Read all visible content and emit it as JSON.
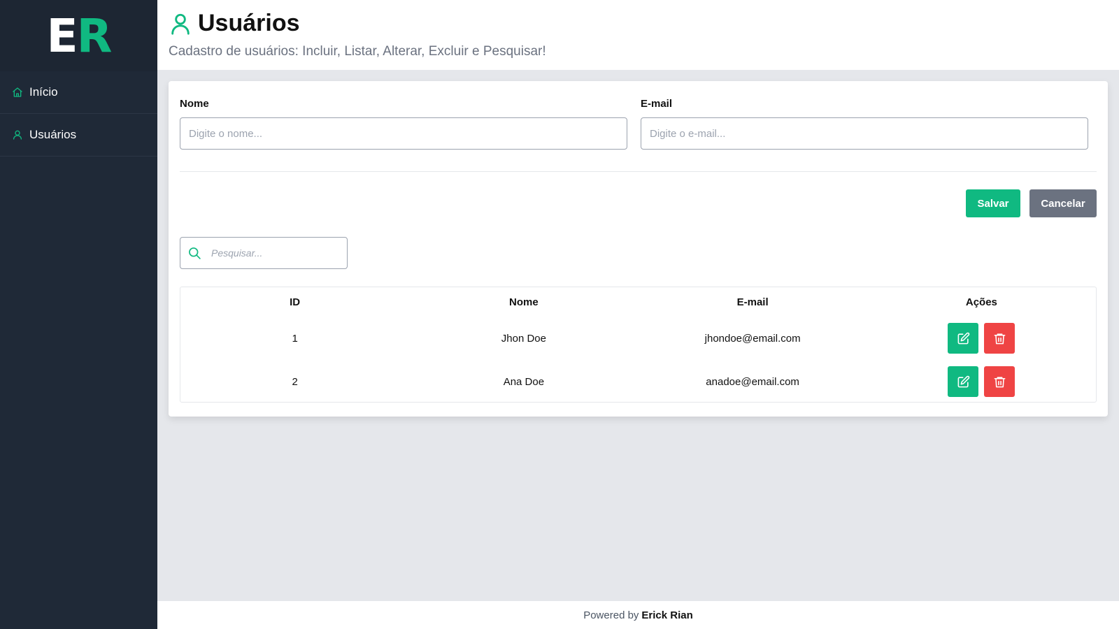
{
  "logo": {
    "first": "E",
    "second": "R"
  },
  "sidebar": {
    "items": [
      {
        "label": "Início",
        "icon": "home-icon"
      },
      {
        "label": "Usuários",
        "icon": "user-icon"
      }
    ]
  },
  "header": {
    "title": "Usuários",
    "subtitle": "Cadastro de usuários: Incluir, Listar, Alterar, Excluir e Pesquisar!",
    "icon": "user-icon"
  },
  "form": {
    "name_label": "Nome",
    "name_placeholder": "Digite o nome...",
    "name_value": "",
    "email_label": "E-mail",
    "email_placeholder": "Digite o e-mail...",
    "email_value": "",
    "save_label": "Salvar",
    "cancel_label": "Cancelar"
  },
  "search": {
    "placeholder": "Pesquisar...",
    "value": "",
    "icon": "search-icon"
  },
  "table": {
    "headers": [
      "ID",
      "Nome",
      "E-mail",
      "Ações"
    ],
    "rows": [
      {
        "id": "1",
        "name": "Jhon Doe",
        "email": "jhondoe@email.com"
      },
      {
        "id": "2",
        "name": "Ana Doe",
        "email": "anadoe@email.com"
      }
    ]
  },
  "footer": {
    "prefix": "Powered by",
    "author": "Erick Rian"
  },
  "colors": {
    "accent": "#10b981",
    "danger": "#ef4444",
    "secondary": "#6b7280",
    "sidebar": "#1f2937"
  }
}
